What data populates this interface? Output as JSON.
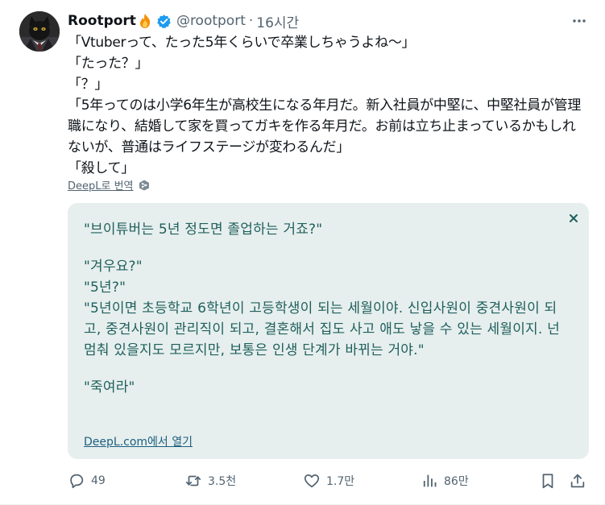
{
  "author": {
    "display_name": "Rootport",
    "handle": "@rootport",
    "separator": "·",
    "time": "16시간"
  },
  "icons": {
    "fire": "fire-emoji-icon",
    "verified": "verified-badge-icon",
    "more": "more-dots-icon",
    "deepl": "deepl-logo-icon",
    "close": "close-icon",
    "reply": "reply-icon",
    "retweet": "retweet-icon",
    "like": "heart-icon",
    "views": "views-bar-chart-icon",
    "bookmark": "bookmark-icon",
    "share": "share-icon"
  },
  "colors": {
    "verified": "#1d9bf0",
    "translation_bg": "#e6efee",
    "translation_text": "#1f5f5c",
    "muted": "#536471"
  },
  "tweet": {
    "lines": [
      "「Vtuberって、たった5年くらいで卒業しちゃうよね～」",
      "「たった？」",
      "「？」",
      "「5年ってのは小学6年生が高校生になる年月だ。新入社員が中堅に、中堅社員が管理職になり、結婚して家を買ってガキを作る年月だ。お前は立ち止まっているかもしれないが、普通はライフステージが変わるんだ」",
      "「殺して」"
    ],
    "translate_label": "DeepL로 번역"
  },
  "translation": {
    "p1": "\"브이튜버는 5년 정도면 졸업하는 거죠?\"",
    "p2": "\"겨우요?\"",
    "p3": "\"5년?\"",
    "p4": "\"5년이면 초등학교 6학년이 고등학생이 되는 세월이야. 신입사원이 중견사원이 되고, 중견사원이 관리직이 되고, 결혼해서 집도 사고 애도 낳을 수 있는 세월이지. 넌 멈춰 있을지도 모르지만, 보통은 인생 단계가 바뀌는 거야.\"",
    "p5": "\"죽여라\"",
    "open_link": "DeepL.com에서 열기"
  },
  "metrics": {
    "replies": "49",
    "retweets": "3.5천",
    "likes": "1.7만",
    "views": "86만"
  }
}
